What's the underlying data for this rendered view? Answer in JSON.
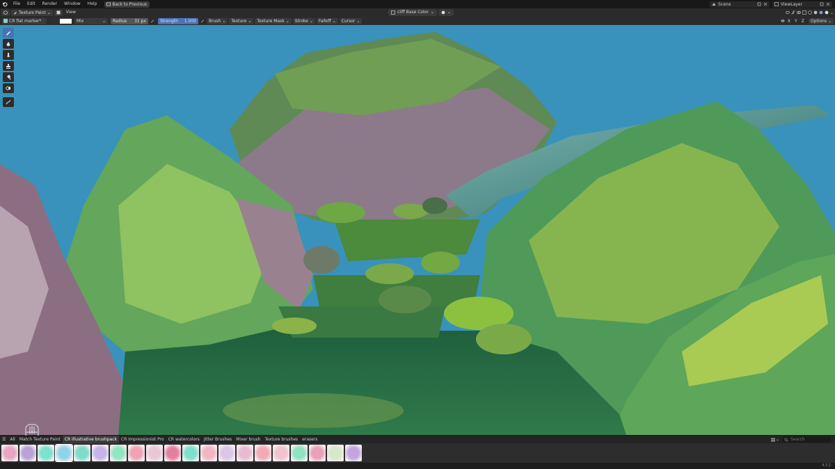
{
  "menu": {
    "items": [
      "File",
      "Edit",
      "Render",
      "Window",
      "Help"
    ],
    "back_label": "Back to Previous"
  },
  "topbar": {
    "scene_label": "Scene",
    "viewlayer_label": "ViewLayer"
  },
  "header": {
    "mode_label": "Texture Paint",
    "view_label": "View",
    "texture_slot_label": "cliff Base Color"
  },
  "tool_settings": {
    "brush_name": "CR flat marker*",
    "blend_mode": "Mix",
    "radius_label": "Radius",
    "radius_value": "31 px",
    "strength_label": "Strength",
    "strength_value": "1.000",
    "dropdowns": [
      "Brush",
      "Texture",
      "Texture Mask",
      "Stroke",
      "Falloff",
      "Cursor"
    ],
    "axis": [
      "X",
      "Y",
      "Z"
    ],
    "options_label": "Options"
  },
  "asset_shelf": {
    "tabs": [
      "All",
      "Match Texture Paint",
      "CR Illustrative brushpack",
      "CR Impressionist Pro",
      "CR watercolors",
      "Jitter Brushes",
      "Mixer brush",
      "Texture brushes",
      "erasers"
    ],
    "active_tab": 2,
    "search_placeholder": "Search",
    "thumbnail_colors": [
      "#e7a7c3",
      "#b7a3d6",
      "#7ee0cf",
      "#8fd3e8",
      "#7fdcc8",
      "#c6b4e8",
      "#8fe6c2",
      "#f0a2b6",
      "#e9c7d4",
      "#e57fa0",
      "#7fe0c9",
      "#f1b6c2",
      "#d9c7e8",
      "#e8bcd0",
      "#f2aab5",
      "#f1c3cf",
      "#8fe3c0",
      "#e9a1b8",
      "#d6e8c8",
      "#c2a5de"
    ]
  },
  "status": {
    "version": "4.3.2"
  },
  "colors": {
    "accent_blue": "#4772b3",
    "sky": "#3892bb",
    "ui_dark": "#2b2b2b"
  }
}
